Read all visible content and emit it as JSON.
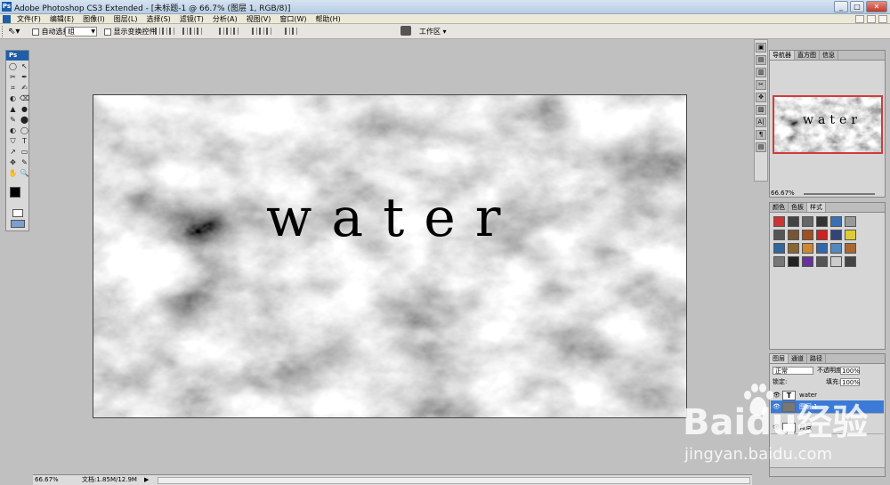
{
  "window": {
    "title": "Adobe Photoshop CS3 Extended - [未标题-1 @ 66.7% (图层 1, RGB/8)]",
    "logo": "Ps",
    "min_label": "_",
    "max_label": "□",
    "close_label": "✕"
  },
  "menu": [
    "文件(F)",
    "编辑(E)",
    "图像(I)",
    "图层(L)",
    "选择(S)",
    "滤镜(T)",
    "分析(A)",
    "视图(V)",
    "窗口(W)",
    "帮助(H)"
  ],
  "options": {
    "auto_select_label": "自动选择:",
    "group_value": "组",
    "show_transform_label": "显示变换控件",
    "workspace_label": "工作区 ▾"
  },
  "toolbox": {
    "title": "Ps",
    "tools": [
      "◯",
      "↖",
      "✂",
      "✒",
      "⌗",
      "✍",
      "◐",
      "⌫",
      "▲",
      "●",
      "✎",
      "⬤",
      "◐",
      "◯",
      "⛉",
      "T",
      "↗",
      "▭",
      "✥",
      "✎",
      "✋",
      "🔍"
    ]
  },
  "document": {
    "text": "water"
  },
  "status": {
    "zoom": "66.67%",
    "doc_info": "文档:1.85M/12.9M",
    "arrow": "▶"
  },
  "dock_icons": [
    "▣",
    "▤",
    "▥",
    "✂",
    "✥",
    "▧",
    "A|",
    "¶",
    "▤"
  ],
  "navigator": {
    "tabs": [
      "导航器",
      "直方图",
      "信息"
    ],
    "thumb_text": "water",
    "zoom": "66.67%"
  },
  "swatches": {
    "tabs": [
      "颜色",
      "色板",
      "样式"
    ],
    "styles": [
      "#cc3333",
      "#444444",
      "#666666",
      "#333333",
      "#3a6fb0",
      "#999999",
      "#555555",
      "#775533",
      "#a05020",
      "#cc2222",
      "#334477",
      "#ddcc33",
      "#336699",
      "#886633",
      "#cc8833",
      "#3366aa",
      "#5588bb",
      "#aa6633",
      "#777777",
      "#222222",
      "#663399",
      "#555555",
      "#cccccc",
      "#444444"
    ]
  },
  "layers": {
    "tabs": [
      "图层",
      "通道",
      "路径"
    ],
    "blend_mode": "正常",
    "opacity_label": "不透明度:",
    "opacity": "100%",
    "lock_label": "锁定:",
    "fill_label": "填充:",
    "fill": "100%",
    "items": [
      {
        "name": "water",
        "thumb": "T"
      },
      {
        "name": "图层 1",
        "thumb": ""
      },
      {
        "name": "背景",
        "thumb": ""
      }
    ]
  },
  "watermark": {
    "logo": "Baidu经验",
    "url": "jingyan.baidu.com"
  }
}
